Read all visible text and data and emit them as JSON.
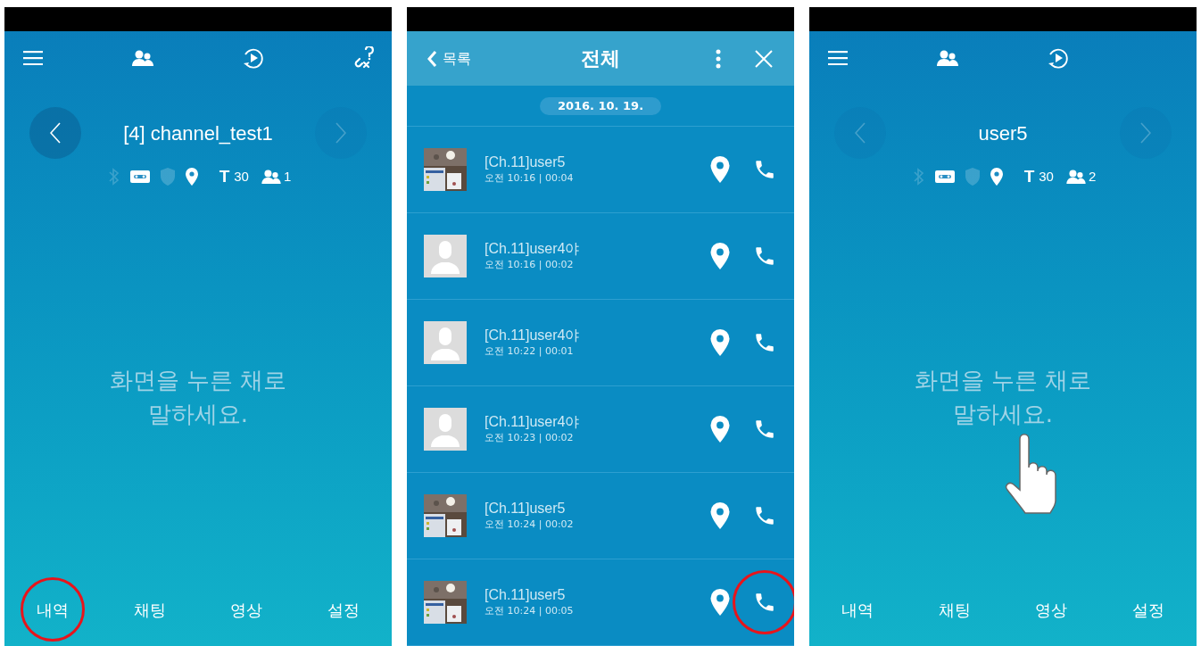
{
  "screens": [
    {
      "kind": "channel",
      "toolbar": [
        {
          "kind": "menu"
        },
        {
          "kind": "members"
        },
        {
          "kind": "replay"
        },
        {
          "kind": "unlink"
        }
      ],
      "title": "[4] channel_test1",
      "prev_disabled": false,
      "next_disabled": true,
      "status": [
        {
          "kind": "bluetooth",
          "on": false
        },
        {
          "kind": "tape",
          "on": true
        },
        {
          "kind": "shield",
          "on": false
        },
        {
          "kind": "pin",
          "on": true
        }
      ],
      "text_size": {
        "label": "T",
        "value": "30"
      },
      "members": "1",
      "hint": "화면을 누른 채로\n말하세요.",
      "pointer": false,
      "tabs": [
        {
          "label": "내역",
          "circled": true
        },
        {
          "label": "채팅",
          "circled": false
        },
        {
          "label": "영상",
          "circled": false
        },
        {
          "label": "설정",
          "circled": false
        }
      ]
    },
    {
      "kind": "list",
      "back": "목록",
      "title": "전체",
      "date": "2016. 10. 19.",
      "rows": [
        {
          "name": "[Ch.11]user5",
          "meta": "오전 10:16 | 00:04",
          "call_circled": false
        },
        {
          "kind": "avatar",
          "name": "[Ch.11]user4야",
          "meta": "오전 10:16 | 00:02",
          "call_circled": false
        },
        {
          "kind": "avatar",
          "name": "[Ch.11]user4야",
          "meta": "오전 10:22 | 00:01",
          "call_circled": false
        },
        {
          "kind": "avatar",
          "name": "[Ch.11]user4야",
          "meta": "오전 10:23 | 00:02",
          "call_circled": false
        },
        {
          "name": "[Ch.11]user5",
          "meta": "오전 10:24 | 00:02",
          "call_circled": false
        },
        {
          "name": "[Ch.11]user5",
          "meta": "오전 10:24 | 00:05",
          "call_circled": true
        }
      ]
    },
    {
      "kind": "channel",
      "toolbar": [
        {
          "kind": "menu"
        },
        {
          "kind": "members"
        },
        {
          "kind": "replay"
        }
      ],
      "title": "user5",
      "prev_disabled": true,
      "next_disabled": true,
      "status": [
        {
          "kind": "bluetooth",
          "on": false
        },
        {
          "kind": "tape",
          "on": true
        },
        {
          "kind": "shield",
          "on": false
        },
        {
          "kind": "pin",
          "on": true
        }
      ],
      "text_size": {
        "label": "T",
        "value": "30"
      },
      "members": "2",
      "hint": "화면을 누른 채로\n말하세요.",
      "pointer": true,
      "tabs": [
        {
          "label": "내역",
          "circled": false
        },
        {
          "label": "채팅",
          "circled": false
        },
        {
          "label": "영상",
          "circled": false
        },
        {
          "label": "설정",
          "circled": false
        }
      ]
    }
  ]
}
